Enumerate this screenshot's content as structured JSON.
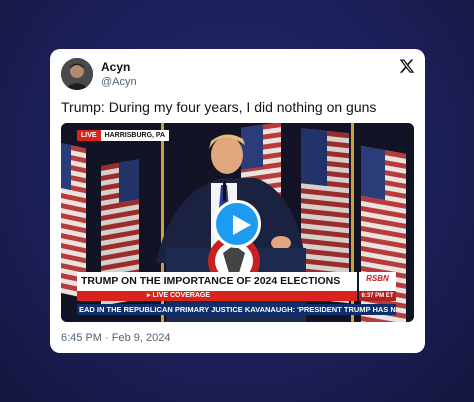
{
  "tweet": {
    "display_name": "Acyn",
    "handle": "@Acyn",
    "text": "Trump: During my four years, I did nothing on guns",
    "timestamp": "6:45 PM · Feb 9, 2024",
    "platform_icon": "x-logo-icon"
  },
  "video": {
    "live_tag": "LIVE",
    "location": "HARRISBURG, PA",
    "headline": "TRUMP ON THE IMPORTANCE OF 2024 ELECTIONS",
    "live_coverage": "LIVE COVERAGE",
    "network": "RSBN",
    "time": "6:37 PM ET",
    "ticker": "EAD IN THE REPUBLICAN PRIMARY   JUSTICE KAVANAUGH: 'PRESIDENT TRUMP HAS NOT BEEN CH",
    "play_icon": "play-icon"
  },
  "colors": {
    "background": "#1d1f5a",
    "accent": "#1d9bf0",
    "live_red": "#d9231d",
    "ticker_blue": "#0e2f6b"
  }
}
